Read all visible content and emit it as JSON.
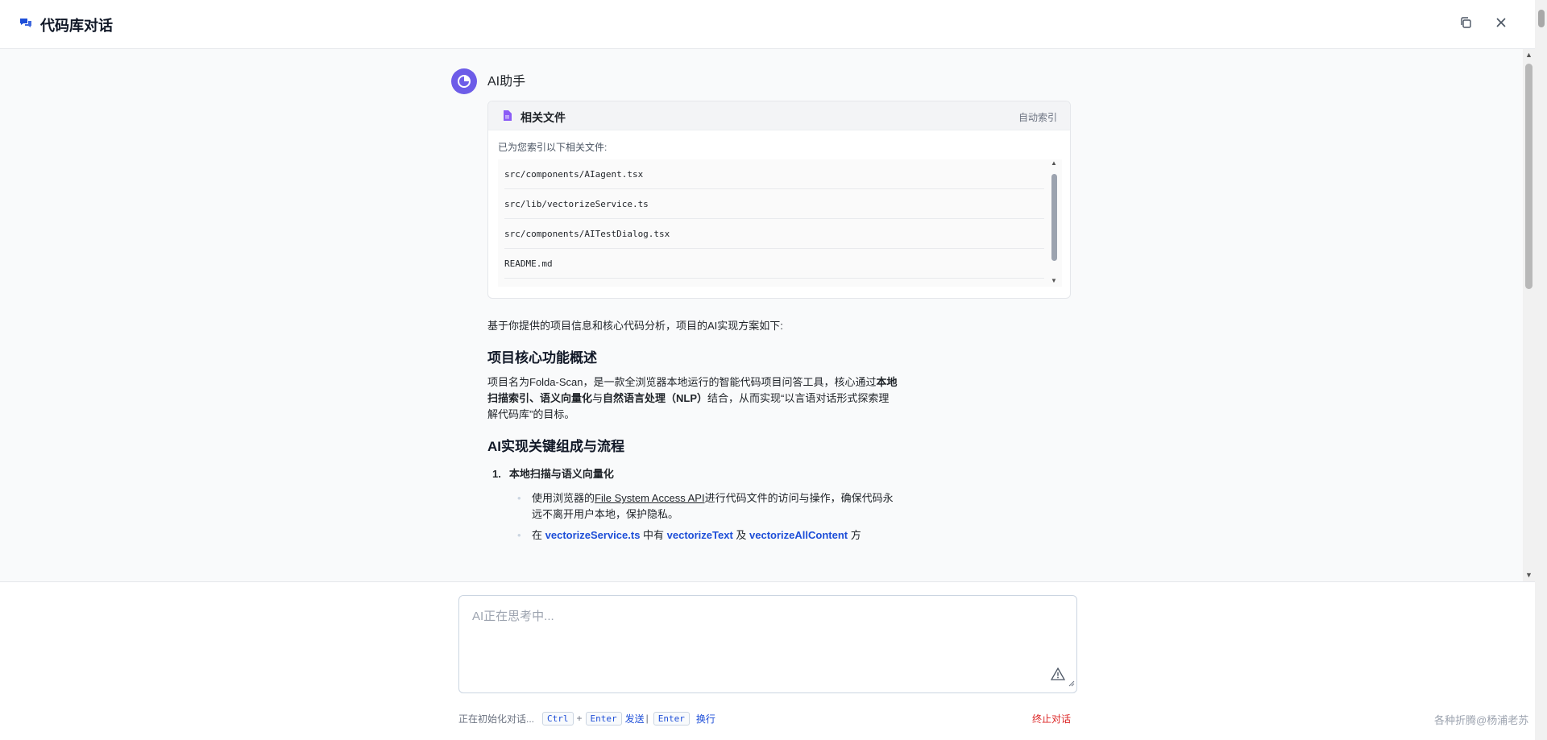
{
  "header": {
    "title": "代码库对话",
    "icons": {
      "title": "chat-icon",
      "copy": "copy-icon",
      "close": "close-icon"
    }
  },
  "message": {
    "sender": "AI助手",
    "avatar_icon": "ai-avatar-icon",
    "files_card": {
      "title": "相关文件",
      "badge": "自动索引",
      "description": "已为您索引以下相关文件:",
      "files": [
        "src/components/AIagent.tsx",
        "src/lib/vectorizeService.ts",
        "src/components/AITestDialog.tsx",
        "README.md"
      ]
    },
    "intro": "基于你提供的项目信息和核心代码分析，项目的AI实现方案如下:",
    "section1": {
      "heading": "项目核心功能概述",
      "p_part1": "项目名为Folda-Scan，是一款全浏览器本地运行的智能代码项目问答工具，核心通过",
      "p_bold1": "本地扫描索引、语义向量化",
      "p_part2": "与",
      "p_bold2": "自然语言处理（NLP）",
      "p_part3": "结合，从而实现“以言语对话形式探索理解代码库”的目标。"
    },
    "section2": {
      "heading": "AI实现关键组成与流程",
      "item1_num": "1.",
      "item1_title": "本地扫描与语义向量化",
      "bullet1_pre": "使用浏览器的",
      "bullet1_link": "File System Access API",
      "bullet1_post": "进行代码文件的访问与操作，确保代码永远不离开用户本地，保护隐私。",
      "bullet2_pre": "在 ",
      "bullet2_code1": "vectorizeService.ts",
      "bullet2_mid1": " 中有 ",
      "bullet2_code2": "vectorizeText",
      "bullet2_mid2": " 及 ",
      "bullet2_code3": "vectorizeAllContent",
      "bullet2_post": " 方"
    }
  },
  "composer": {
    "placeholder": "AI正在思考中...",
    "status": "正在初始化对话...",
    "kbd_ctrl": "Ctrl",
    "plus": "+",
    "kbd_enter": "Enter",
    "send": "发送",
    "sep": "|",
    "kbd_enter2": "Enter",
    "newline": "换行",
    "stop": "终止对话",
    "warn_icon": "warning-icon"
  },
  "watermark": "各种折腾@杨浦老苏",
  "colors": {
    "accent": "#1d4ed8",
    "avatar": "#6d5ce8",
    "danger": "#dc2626",
    "file_icon": "#8b5cf6"
  }
}
